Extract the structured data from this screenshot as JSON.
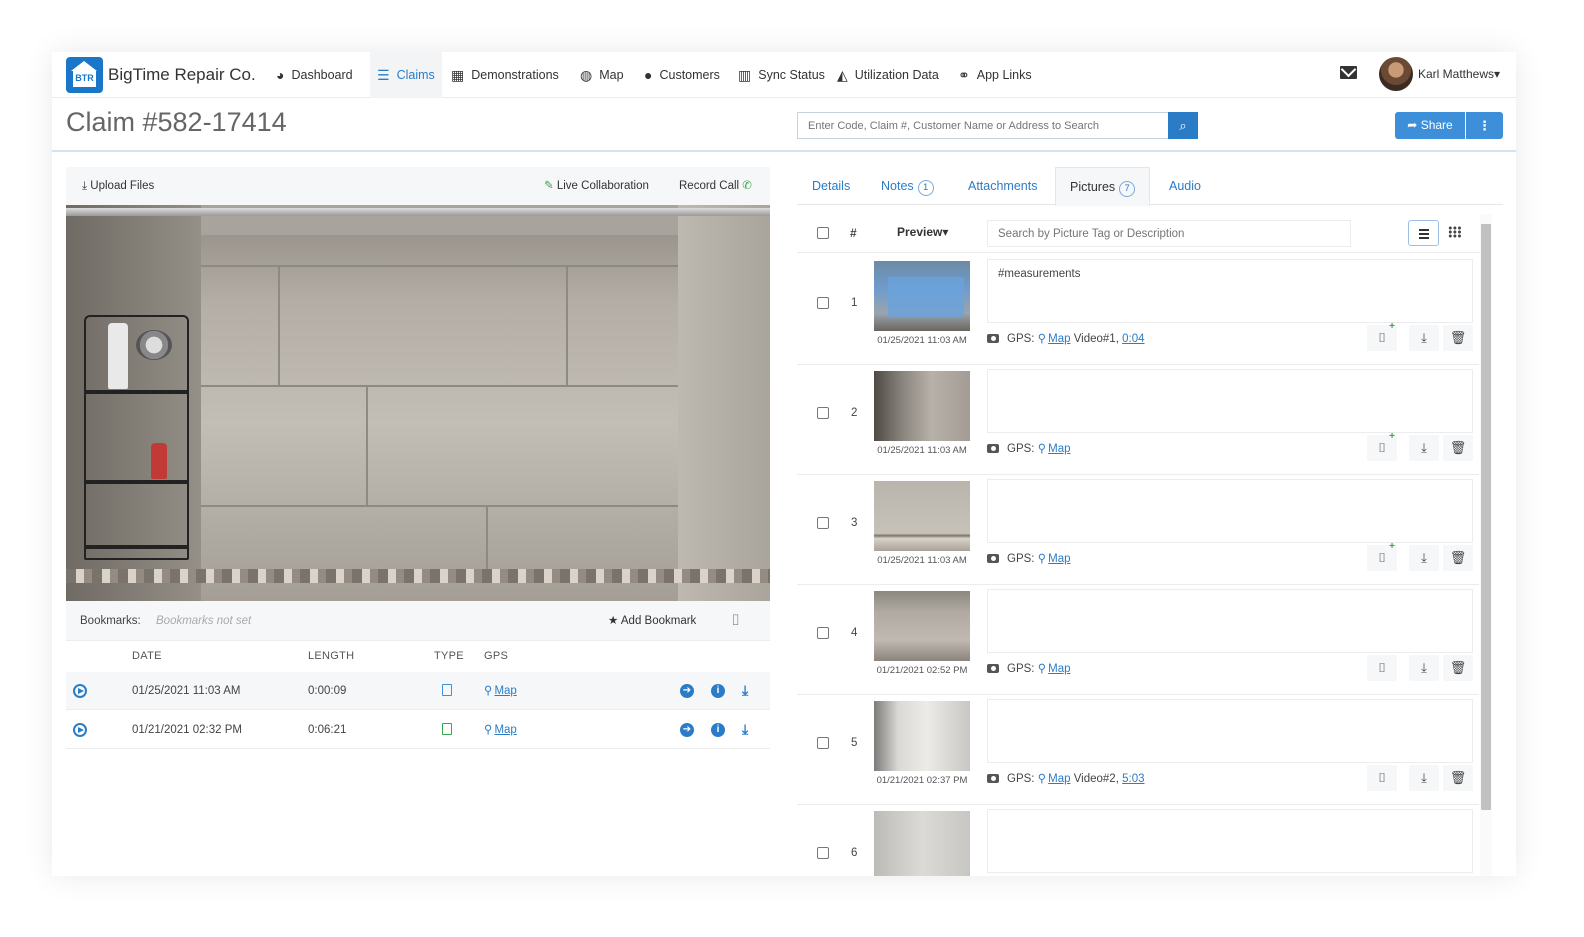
{
  "brand": {
    "name": "BigTime Repair Co.",
    "logo_text": "BTR"
  },
  "nav": {
    "items": [
      {
        "label": "Dashboard",
        "icon": "dashboard-icon",
        "glyph": "◕"
      },
      {
        "label": "Claims",
        "icon": "claims-icon",
        "glyph": "☰",
        "active": true
      },
      {
        "label": "Demonstrations",
        "icon": "film-icon",
        "glyph": "▦"
      },
      {
        "label": "Map",
        "icon": "globe-icon",
        "glyph": "◍"
      },
      {
        "label": "Customers",
        "icon": "user-icon",
        "glyph": "●"
      },
      {
        "label": "Sync Status",
        "icon": "bar-chart-icon",
        "glyph": "▥"
      },
      {
        "label": "Utilization Data",
        "icon": "area-chart-icon",
        "glyph": "◭"
      },
      {
        "label": "App Links",
        "icon": "link-icon",
        "glyph": "⚭"
      }
    ],
    "user_name": "Karl Matthews",
    "user_caret": "▾"
  },
  "header": {
    "claim_title": "Claim #582-17414",
    "search_placeholder": "Enter Code, Claim #, Customer Name or Address to Search",
    "share_label": "Share",
    "share_glyph": "➦",
    "more_glyph": "⋮"
  },
  "left_toolbar": {
    "upload_label": "Upload Files",
    "upload_glyph": "⤓",
    "live_label": "Live Collaboration",
    "live_glyph": "✎",
    "record_label": "Record Call",
    "record_glyph": "✆"
  },
  "bookmarks": {
    "label": "Bookmarks:",
    "empty_text": "Bookmarks not set",
    "add_label": "Add Bookmark",
    "add_glyph": "★",
    "tag_glyph": "⌷"
  },
  "videos": {
    "columns": [
      "DATE",
      "LENGTH",
      "TYPE",
      "GPS"
    ],
    "rows": [
      {
        "date": "01/25/2021 11:03 AM",
        "length": "0:00:09",
        "type_color": "#3d8fd9",
        "gps": "Map"
      },
      {
        "date": "01/21/2021 02:32 PM",
        "length": "0:06:21",
        "type_color": "#3aa64a",
        "gps": "Map"
      }
    ]
  },
  "tabs": {
    "items": [
      {
        "label": "Details",
        "badge": ""
      },
      {
        "label": "Notes",
        "badge": "1"
      },
      {
        "label": "Attachments",
        "badge": ""
      },
      {
        "label": "Pictures",
        "badge": "7",
        "active": true
      },
      {
        "label": "Audio",
        "badge": ""
      }
    ]
  },
  "pictures": {
    "hash_header": "#",
    "preview_label": "Preview",
    "preview_caret": "▾",
    "search_placeholder": "Search by Picture Tag or Description",
    "gps_label": "GPS:",
    "items": [
      {
        "num": "1",
        "date": "01/25/2021 11:03 AM",
        "desc": "#measurements",
        "gps": "Map",
        "video": "Video#1,",
        "video_time": "0:04",
        "tag_plus": true
      },
      {
        "num": "2",
        "date": "01/25/2021 11:03 AM",
        "desc": "",
        "gps": "Map",
        "video": "",
        "video_time": "",
        "tag_plus": true
      },
      {
        "num": "3",
        "date": "01/25/2021 11:03 AM",
        "desc": "",
        "gps": "Map",
        "video": "",
        "video_time": "",
        "tag_plus": true
      },
      {
        "num": "4",
        "date": "01/21/2021 02:52 PM",
        "desc": "",
        "gps": "Map",
        "video": "",
        "video_time": "",
        "tag_plus": false
      },
      {
        "num": "5",
        "date": "01/21/2021 02:37 PM",
        "desc": "",
        "gps": "Map",
        "video": "Video#2,",
        "video_time": "5:03",
        "tag_plus": false
      },
      {
        "num": "6",
        "date": "",
        "desc": "",
        "gps": "",
        "video": "",
        "video_time": "",
        "tag_plus": false
      }
    ]
  },
  "colors": {
    "accent": "#2a7cc7",
    "green": "#3aa64a"
  }
}
